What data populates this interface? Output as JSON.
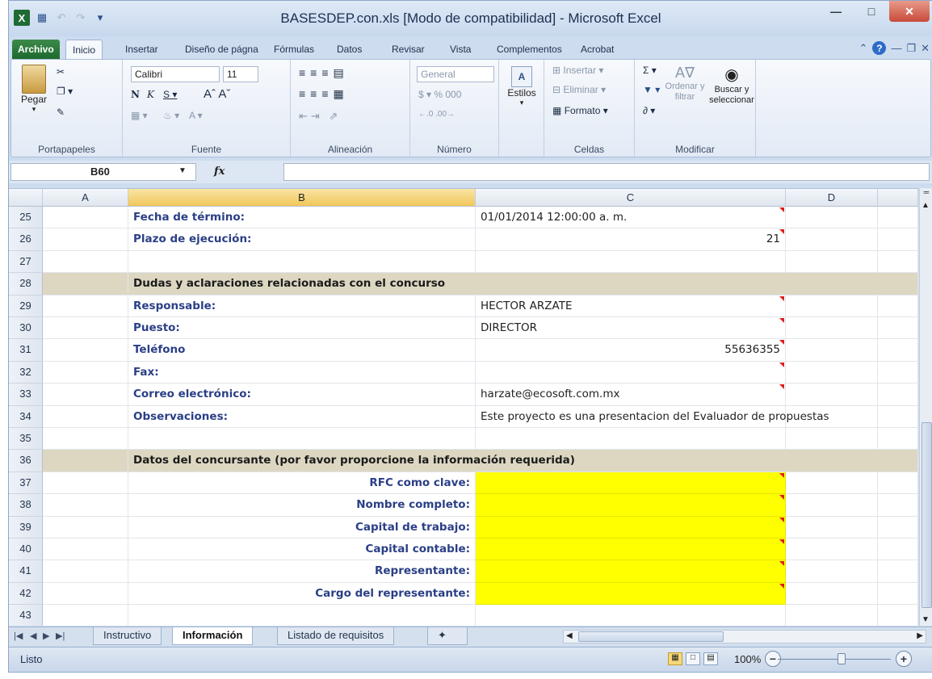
{
  "window": {
    "title": "BASESDEP.con.xls [Modo de compatibilidad] - Microsoft Excel"
  },
  "ribbon_tabs": [
    "Archivo",
    "Inicio",
    "Insertar",
    "Diseño de págna",
    "Fórmulas",
    "Datos",
    "Revisar",
    "Vista",
    "Complementos",
    "Acrobat"
  ],
  "ribbon": {
    "portapapeles": {
      "paste": "Pegar",
      "label": "Portapapeles"
    },
    "fuente": {
      "font": "Calibri",
      "size": "11",
      "label": "Fuente"
    },
    "alineacion": {
      "label": "Alineación"
    },
    "numero": {
      "format": "General",
      "label": "Número"
    },
    "estilos": {
      "button": "Estilos"
    },
    "celdas": {
      "insert": "Insertar",
      "delete": "Eliminar",
      "format": "Formato",
      "label": "Celdas"
    },
    "modificar": {
      "sort": "Ordenar y filtrar",
      "find1": "Buscar y",
      "find2": "seleccionar",
      "label": "Modificar"
    }
  },
  "formula_bar": {
    "name_box": "B60",
    "fx": "fx",
    "formula": ""
  },
  "columns": [
    "A",
    "B",
    "C",
    "D"
  ],
  "rows": [
    {
      "n": "25",
      "b": "Fecha de término:",
      "c": "01/01/2014 12:00:00 a. m."
    },
    {
      "n": "26",
      "b": "Plazo de ejecución:",
      "c": "21"
    },
    {
      "n": "27",
      "b": "",
      "c": ""
    },
    {
      "n": "28",
      "b": "Dudas y aclaraciones relacionadas con el concurso",
      "c": ""
    },
    {
      "n": "29",
      "b": "Responsable:",
      "c": "HECTOR ARZATE"
    },
    {
      "n": "30",
      "b": "Puesto:",
      "c": "DIRECTOR"
    },
    {
      "n": "31",
      "b": "Teléfono",
      "c": "55636355"
    },
    {
      "n": "32",
      "b": "Fax:",
      "c": ""
    },
    {
      "n": "33",
      "b": "Correo electrónico:",
      "c": "harzate@ecosoft.com.mx"
    },
    {
      "n": "34",
      "b": "Observaciones:",
      "c": "Este proyecto es una presentacion del Evaluador de propuestas"
    },
    {
      "n": "35",
      "b": "",
      "c": ""
    },
    {
      "n": "36",
      "b": "Datos del concursante (por favor proporcione la información requerida)",
      "c": ""
    },
    {
      "n": "37",
      "b": "RFC como clave:",
      "c": ""
    },
    {
      "n": "38",
      "b": "Nombre completo:",
      "c": ""
    },
    {
      "n": "39",
      "b": "Capital de trabajo:",
      "c": ""
    },
    {
      "n": "40",
      "b": "Capital contable:",
      "c": ""
    },
    {
      "n": "41",
      "b": "Representante:",
      "c": ""
    },
    {
      "n": "42",
      "b": "Cargo del representante:",
      "c": ""
    },
    {
      "n": "43",
      "b": "",
      "c": ""
    }
  ],
  "sheet_tabs": [
    "Instructivo",
    "Información",
    "Listado de requisitos"
  ],
  "status": {
    "text": "Listo",
    "zoom": "100%"
  },
  "colors": {
    "section_fill": "#ddd7c2",
    "input_fill": "#ffff00",
    "label_blue": "#2a3f86"
  }
}
